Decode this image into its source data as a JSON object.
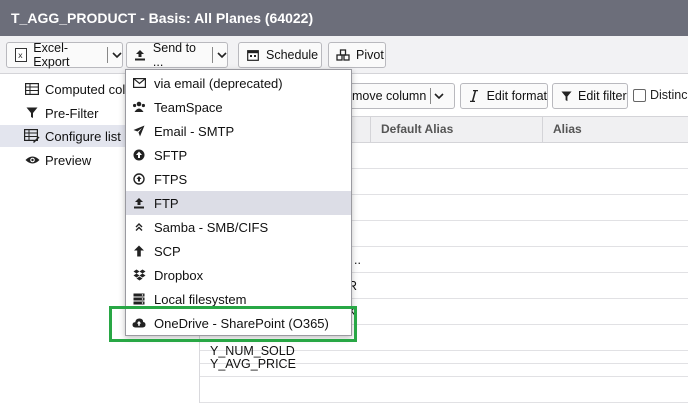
{
  "window": {
    "title": "T_AGG_PRODUCT - Basis: All Planes (64022)"
  },
  "toolbar": {
    "excel_export": "Excel-Export",
    "send_to": "Send to ...",
    "schedule": "Schedule",
    "pivot": "Pivot"
  },
  "sidebar": {
    "items": [
      {
        "label": "Computed col",
        "icon": "table-icon"
      },
      {
        "label": "Pre-Filter",
        "icon": "filter-icon"
      },
      {
        "label": "Configure list",
        "icon": "table-edit-icon",
        "active": true
      },
      {
        "label": "Preview",
        "icon": "eye-icon"
      }
    ]
  },
  "main_toolbar": {
    "remove_column": "emove column",
    "edit_format": "Edit format",
    "edit_filter": "Edit filter",
    "distinct": "Distinc"
  },
  "table": {
    "headers": [
      "Default Alias",
      "Alias"
    ],
    "rows": [
      "",
      "",
      "",
      "",
      "..",
      "R",
      "K",
      "",
      "Y_NUM_SOLD",
      "Y_AVG_PRICE",
      ""
    ]
  },
  "send_to_menu": {
    "items": [
      {
        "label": "via email (deprecated)",
        "icon": "envelope-icon"
      },
      {
        "label": "TeamSpace",
        "icon": "users-icon"
      },
      {
        "label": "Email - SMTP",
        "icon": "paper-plane-icon"
      },
      {
        "label": "SFTP",
        "icon": "circle-arrow-up-icon"
      },
      {
        "label": "FTPS",
        "icon": "circle-arrow-up-outline-icon"
      },
      {
        "label": "FTP",
        "icon": "upload-icon",
        "hover": true
      },
      {
        "label": "Samba - SMB/CIFS",
        "icon": "double-chevron-up-icon"
      },
      {
        "label": "SCP",
        "icon": "arrow-up-icon"
      },
      {
        "label": "Dropbox",
        "icon": "dropbox-icon"
      },
      {
        "label": "Local filesystem",
        "icon": "server-icon"
      },
      {
        "label": "OneDrive - SharePoint (O365)",
        "icon": "cloud-upload-icon"
      }
    ]
  },
  "colors": {
    "titlebar": "#6c6e7a",
    "highlight": "#28a745",
    "hover": "#dcdde6"
  }
}
